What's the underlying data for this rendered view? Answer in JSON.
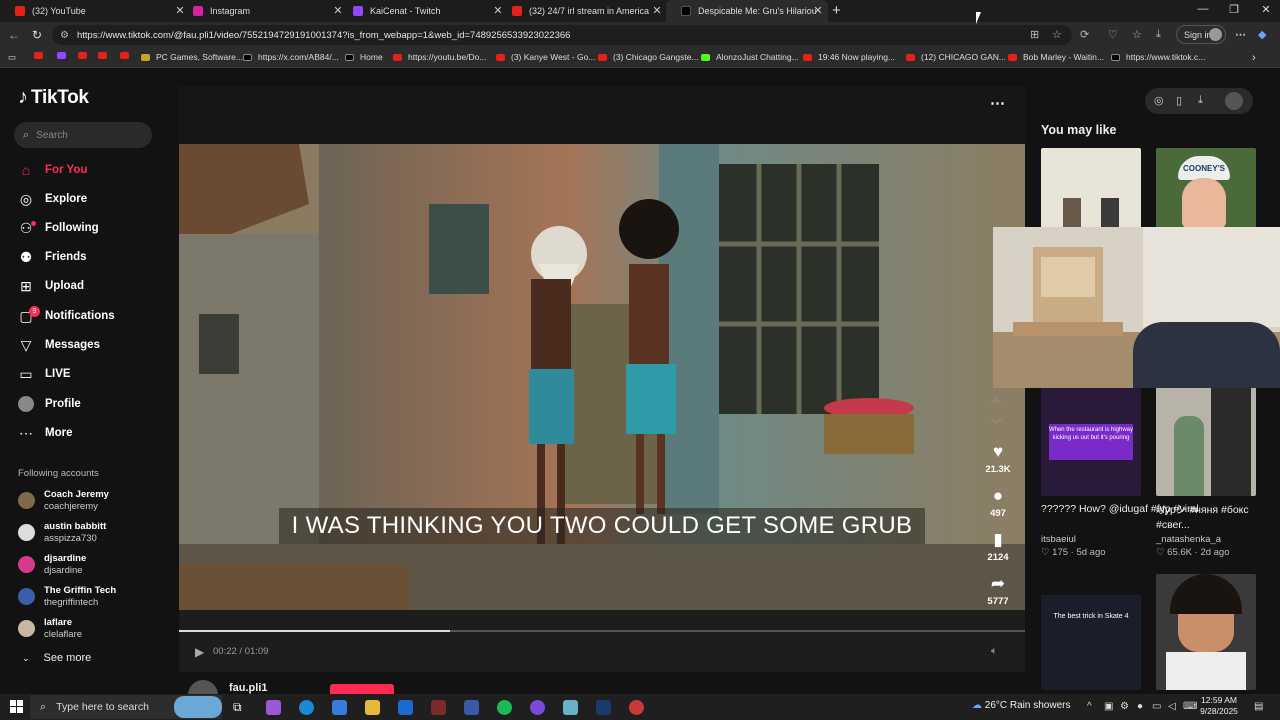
{
  "browser": {
    "tabs": [
      {
        "title": "(32) YouTube",
        "color": "#e62117"
      },
      {
        "title": "Instagram",
        "color": "#d6249f"
      },
      {
        "title": "KaiCenat - Twitch",
        "color": "#9146ff"
      },
      {
        "title": "(32) 24/7 irl stream in America ur",
        "color": "#e62117"
      },
      {
        "title": "Despicable Me: Gru's Hilarious W",
        "color": "#000000"
      }
    ],
    "url": "https://www.tiktok.com/@fau.pli1/video/7552194729191001374?is_from_webapp=1&web_id=7489256533923022366",
    "signin_label": "Sign in",
    "bookmarks": [
      "PC Games, Software...",
      "https://x.com/AB84/...",
      "Home",
      "https://youtu.be/Do...",
      "(3) Kanye West - Go...",
      "(3) Chicago Gangste...",
      "AlonzoJust Chatting...",
      "19:46 Now playing...",
      "(12) CHICAGO GAN...",
      "Bob Marley - Waitin...",
      "https://www.tiktok.c..."
    ]
  },
  "tiktok": {
    "logo": "TikTok",
    "search_placeholder": "Search",
    "nav": [
      {
        "label": "For You",
        "icon": "home-icon"
      },
      {
        "label": "Explore",
        "icon": "compass-icon"
      },
      {
        "label": "Following",
        "icon": "following-icon"
      },
      {
        "label": "Friends",
        "icon": "friends-icon"
      },
      {
        "label": "Upload",
        "icon": "upload-icon"
      },
      {
        "label": "Notifications",
        "icon": "notifications-icon",
        "badge": "9"
      },
      {
        "label": "Messages",
        "icon": "messages-icon"
      },
      {
        "label": "LIVE",
        "icon": "live-icon"
      },
      {
        "label": "Profile",
        "icon": "profile-icon"
      },
      {
        "label": "More",
        "icon": "more-icon"
      }
    ],
    "following_accounts_title": "Following accounts",
    "following_accounts": [
      {
        "name": "Coach Jeremy",
        "handle": "coachjeremy"
      },
      {
        "name": "austin babbitt",
        "handle": "asspizza730"
      },
      {
        "name": "djsardine",
        "handle": "djsardine"
      },
      {
        "name": "The Griffin Tech",
        "handle": "thegriffintech"
      },
      {
        "name": "laflare",
        "handle": "clelaflare"
      }
    ],
    "see_more": "See more",
    "video": {
      "subtitle": "I WAS THINKING YOU TWO COULD GET SOME GRUB",
      "current_time": "00:22",
      "duration": "01:09",
      "time_text": "00:22 / 01:09",
      "progress": 0.32,
      "author": "fau.pli1",
      "likes": "21.3K",
      "comments": "497",
      "saves": "2124",
      "shares": "5777"
    },
    "you_may_like_title": "You may like",
    "recommendations": [
      {
        "caption": "?????? How? @idugaf #fyp #viral",
        "user": "itsbaeiul",
        "likes": "175",
        "age": "5d ago",
        "thumb_text": "When the restaurant is highway kicking us out but it's pouring"
      },
      {
        "caption": "#fypシ #няня #бокс #свег...",
        "user": "_natashenka_a",
        "likes": "65.6K",
        "age": "2d ago"
      },
      {
        "thumb_text": "The best trick in Skate 4"
      }
    ],
    "thumb_card2_text": "COONEY'S"
  },
  "taskbar": {
    "search_placeholder": "Type here to search",
    "weather": "26°C  Rain showers",
    "time": "12:59 AM",
    "date": "9/28/2025"
  }
}
